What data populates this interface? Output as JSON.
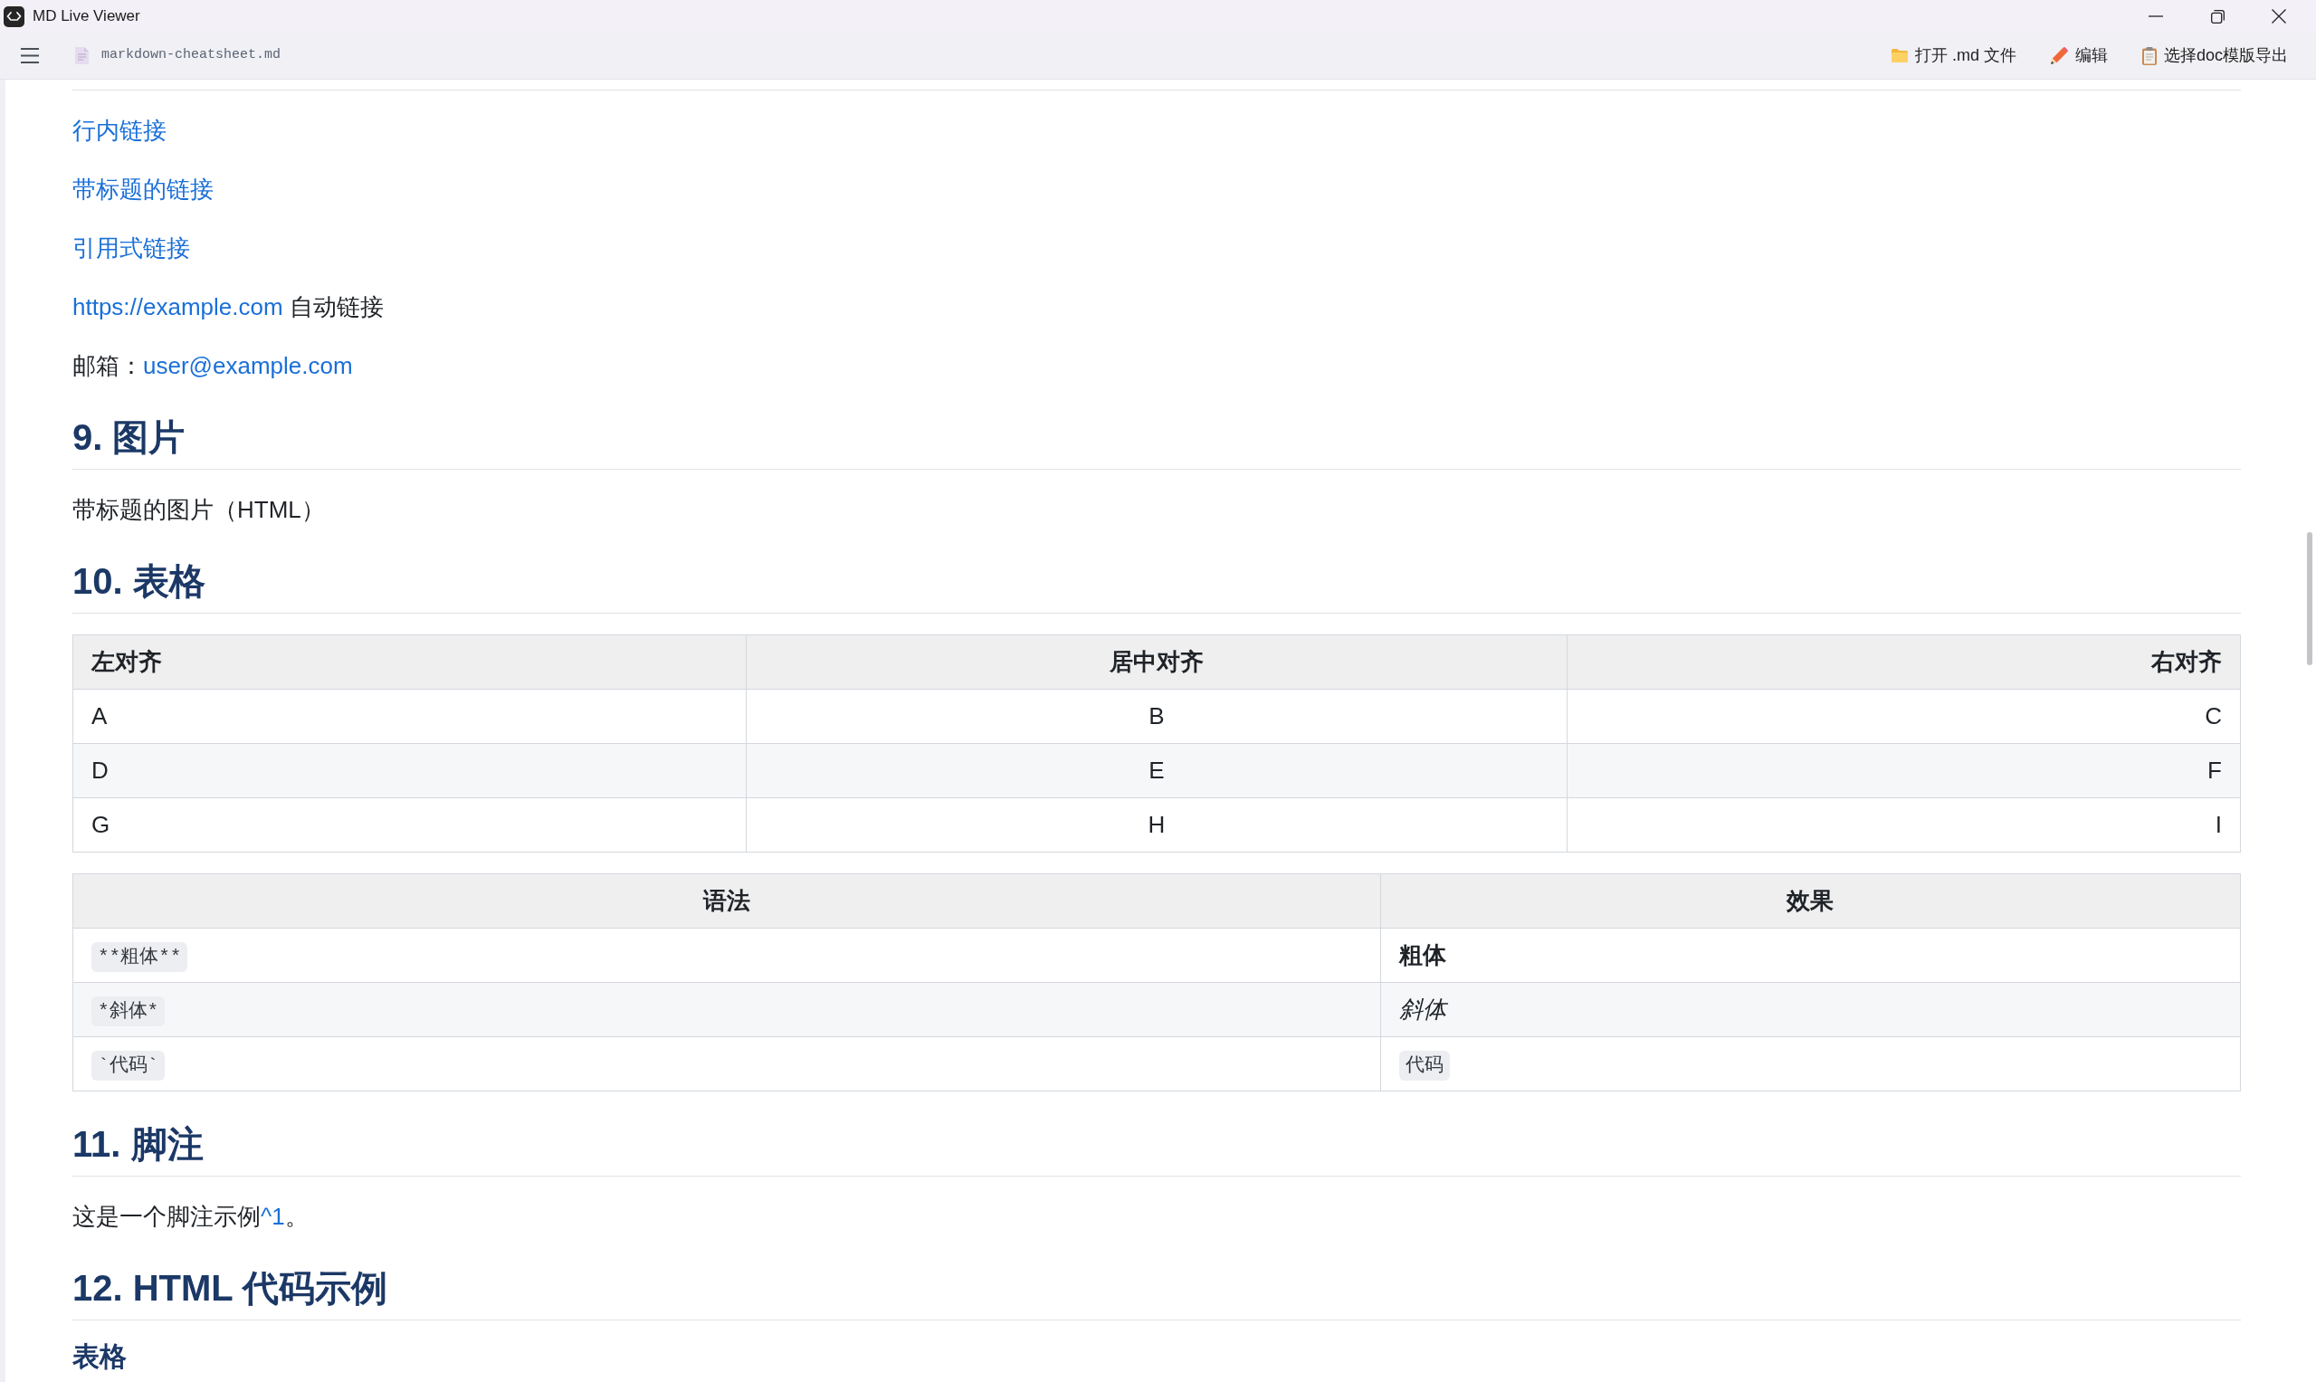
{
  "window": {
    "title": "MD Live Viewer"
  },
  "toolbar": {
    "file_name": "markdown-cheatsheet.md",
    "actions": [
      {
        "kind": "open",
        "label": "打开 .md 文件"
      },
      {
        "kind": "edit",
        "label": "编辑"
      },
      {
        "kind": "export",
        "label": "选择doc模版导出"
      }
    ]
  },
  "document": {
    "blocks": [
      {
        "kind": "paragraph",
        "runs": [
          {
            "kind": "link",
            "text": "行内链接"
          }
        ]
      },
      {
        "kind": "paragraph",
        "runs": [
          {
            "kind": "link",
            "text": "带标题的链接"
          }
        ]
      },
      {
        "kind": "paragraph",
        "runs": [
          {
            "kind": "link",
            "text": "引用式链接"
          }
        ]
      },
      {
        "kind": "paragraph",
        "runs": [
          {
            "kind": "link",
            "text": "https://example.com"
          },
          {
            "kind": "text",
            "text": " 自动链接"
          }
        ]
      },
      {
        "kind": "paragraph",
        "runs": [
          {
            "kind": "text",
            "text": "邮箱："
          },
          {
            "kind": "link",
            "text": "user@example.com"
          }
        ]
      },
      {
        "kind": "heading",
        "text": "9. 图片"
      },
      {
        "kind": "paragraph",
        "runs": [
          {
            "kind": "text",
            "text": "带标题的图片（HTML）"
          }
        ]
      },
      {
        "kind": "heading",
        "text": "10. 表格"
      },
      {
        "kind": "table",
        "columns": [
          {
            "label": "左对齐",
            "kind": "left"
          },
          {
            "label": "居中对齐",
            "kind": "center"
          },
          {
            "label": "右对齐",
            "kind": "right"
          }
        ],
        "rows": [
          [
            {
              "kind": "text",
              "text": "A"
            },
            {
              "kind": "text",
              "text": "B"
            },
            {
              "kind": "text",
              "text": "C"
            }
          ],
          [
            {
              "kind": "text",
              "text": "D"
            },
            {
              "kind": "text",
              "text": "E"
            },
            {
              "kind": "text",
              "text": "F"
            }
          ],
          [
            {
              "kind": "text",
              "text": "G"
            },
            {
              "kind": "text",
              "text": "H"
            },
            {
              "kind": "text",
              "text": "I"
            }
          ]
        ]
      },
      {
        "kind": "table",
        "columns": [
          {
            "label": "语法",
            "kind": "default"
          },
          {
            "label": "效果",
            "kind": "default"
          }
        ],
        "rows": [
          [
            {
              "kind": "code",
              "text": "**粗体**"
            },
            {
              "kind": "bold",
              "text": "粗体"
            }
          ],
          [
            {
              "kind": "code",
              "text": "*斜体*"
            },
            {
              "kind": "italic",
              "text": "斜体"
            }
          ],
          [
            {
              "kind": "code",
              "text": "`代码`"
            },
            {
              "kind": "code",
              "text": "代码"
            }
          ]
        ]
      },
      {
        "kind": "heading",
        "text": "11. 脚注"
      },
      {
        "kind": "paragraph",
        "runs": [
          {
            "kind": "text",
            "text": "这是一个脚注示例"
          },
          {
            "kind": "link",
            "text": "^1"
          },
          {
            "kind": "text",
            "text": "。"
          }
        ]
      },
      {
        "kind": "heading",
        "text": "12. HTML 代码示例"
      },
      {
        "kind": "subheading",
        "text": "表格"
      }
    ]
  }
}
